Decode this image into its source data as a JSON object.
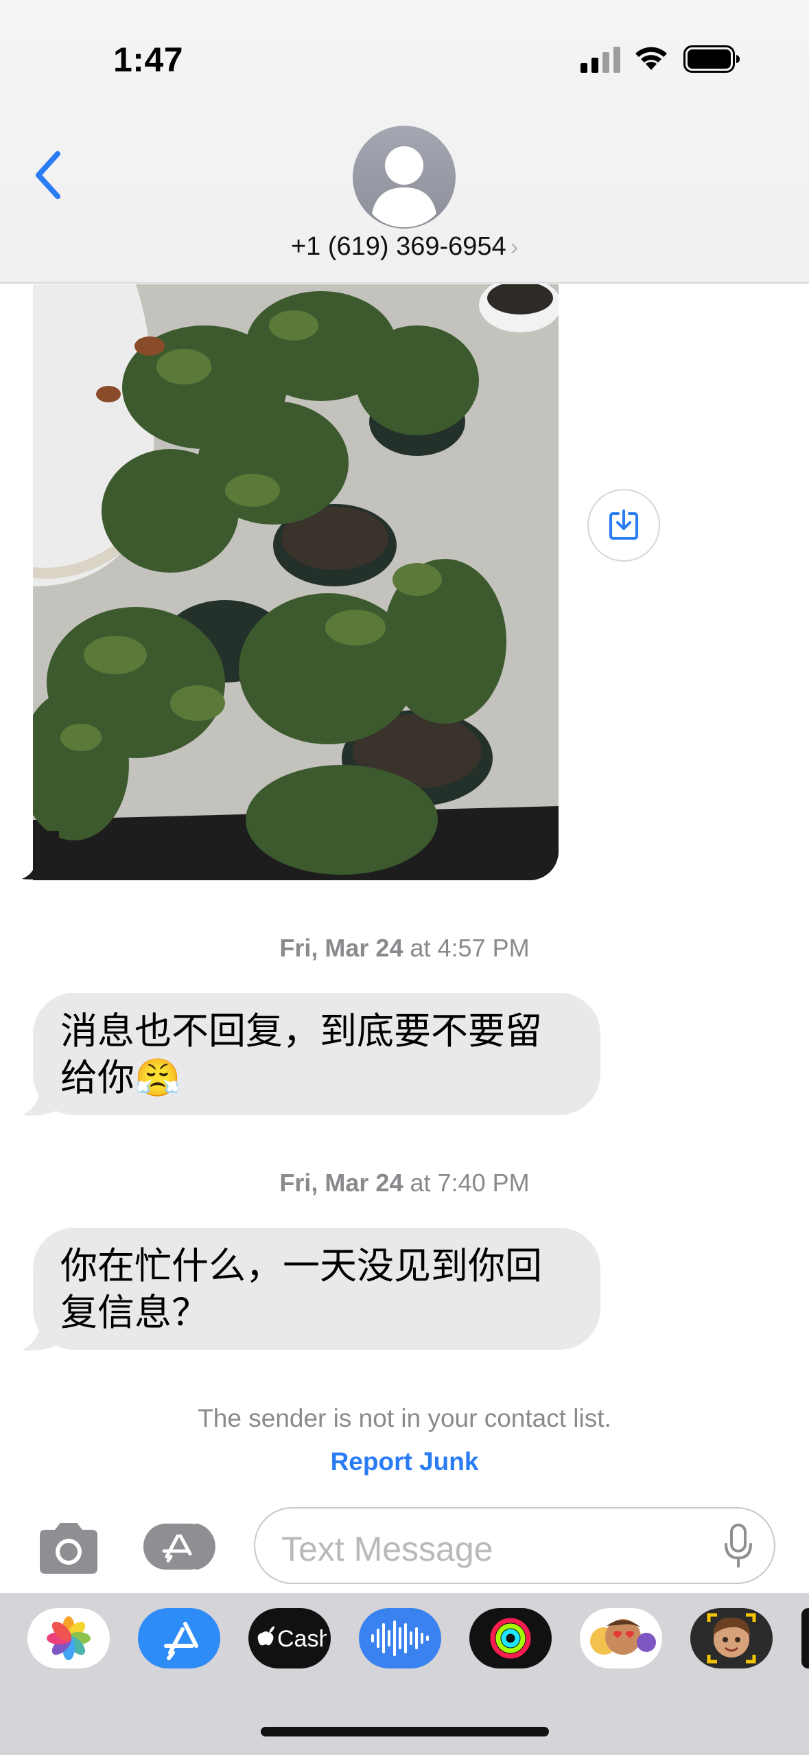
{
  "status_bar": {
    "time": "1:47"
  },
  "header": {
    "contact": "+1 (619) 369-6954",
    "chevron": "›"
  },
  "photo": {
    "description": "Potted rose plants photo"
  },
  "messages": [
    {
      "timestamp_day": "Fri, Mar 24",
      "timestamp_time": "at 4:57 PM",
      "text": "消息也不回复，到底要不要留给你😤"
    },
    {
      "timestamp_day": "Fri, Mar 24",
      "timestamp_time": "at 7:40 PM",
      "text": "你在忙什么，一天没见到你回复信息？"
    }
  ],
  "junk_notice": {
    "text": "The sender is not in your contact list.",
    "report_label": "Report Junk"
  },
  "composer": {
    "placeholder": "Text Message"
  },
  "app_drawer": {
    "apps": [
      {
        "name": "Photos",
        "icon": "photos-icon"
      },
      {
        "name": "App Store",
        "icon": "app-store-icon"
      },
      {
        "name": "Apple Cash",
        "icon": "apple-cash-icon",
        "label": "Cash"
      },
      {
        "name": "Audio",
        "icon": "audio-icon"
      },
      {
        "name": "Fitness",
        "icon": "fitness-rings-icon"
      },
      {
        "name": "Memoji Stickers",
        "icon": "memoji-stickers-icon"
      },
      {
        "name": "Memoji",
        "icon": "memoji-icon"
      }
    ]
  },
  "colors": {
    "accent": "#2a7cf4",
    "bubble": "#e9e9eb",
    "secondary_text": "#8a8a8e"
  }
}
